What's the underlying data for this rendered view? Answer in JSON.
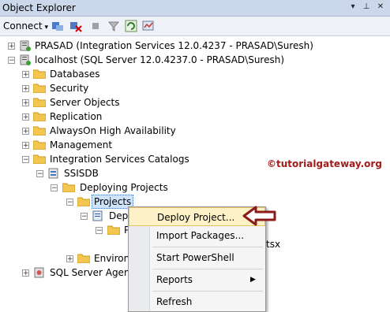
{
  "window": {
    "title": "Object Explorer"
  },
  "toolbar": {
    "connect_label": "Connect"
  },
  "tree": {
    "prasad": "PRASAD (Integration Services 12.0.4237 - PRASAD\\Suresh)",
    "localhost": "localhost (SQL Server 12.0.4237.0 - PRASAD\\Suresh)",
    "databases": "Databases",
    "security": "Security",
    "server_objects": "Server Objects",
    "replication": "Replication",
    "alwayson": "AlwaysOn High Availability",
    "management": "Management",
    "is_catalogs": "Integration Services Catalogs",
    "ssisdb": "SSISDB",
    "deploying_projects": "Deploying Projects",
    "projects": "Projects",
    "deploy_partial": "Depl",
    "p_partial": "P",
    "tsx_partial": "tsx",
    "environments_partial": "Environ",
    "sql_agent": "SQL Server Agent"
  },
  "context_menu": {
    "items": [
      "Deploy Project...",
      "Import Packages...",
      "Start PowerShell",
      "Reports",
      "Refresh"
    ]
  },
  "watermark": "©tutorialgateway.org",
  "colors": {
    "titlebar": "#cbd7ea",
    "selection": "#cfe3fb",
    "menu_highlight": "#fdf1c8",
    "arrow": "#8b1a1a",
    "folder": "#f3c74f"
  }
}
